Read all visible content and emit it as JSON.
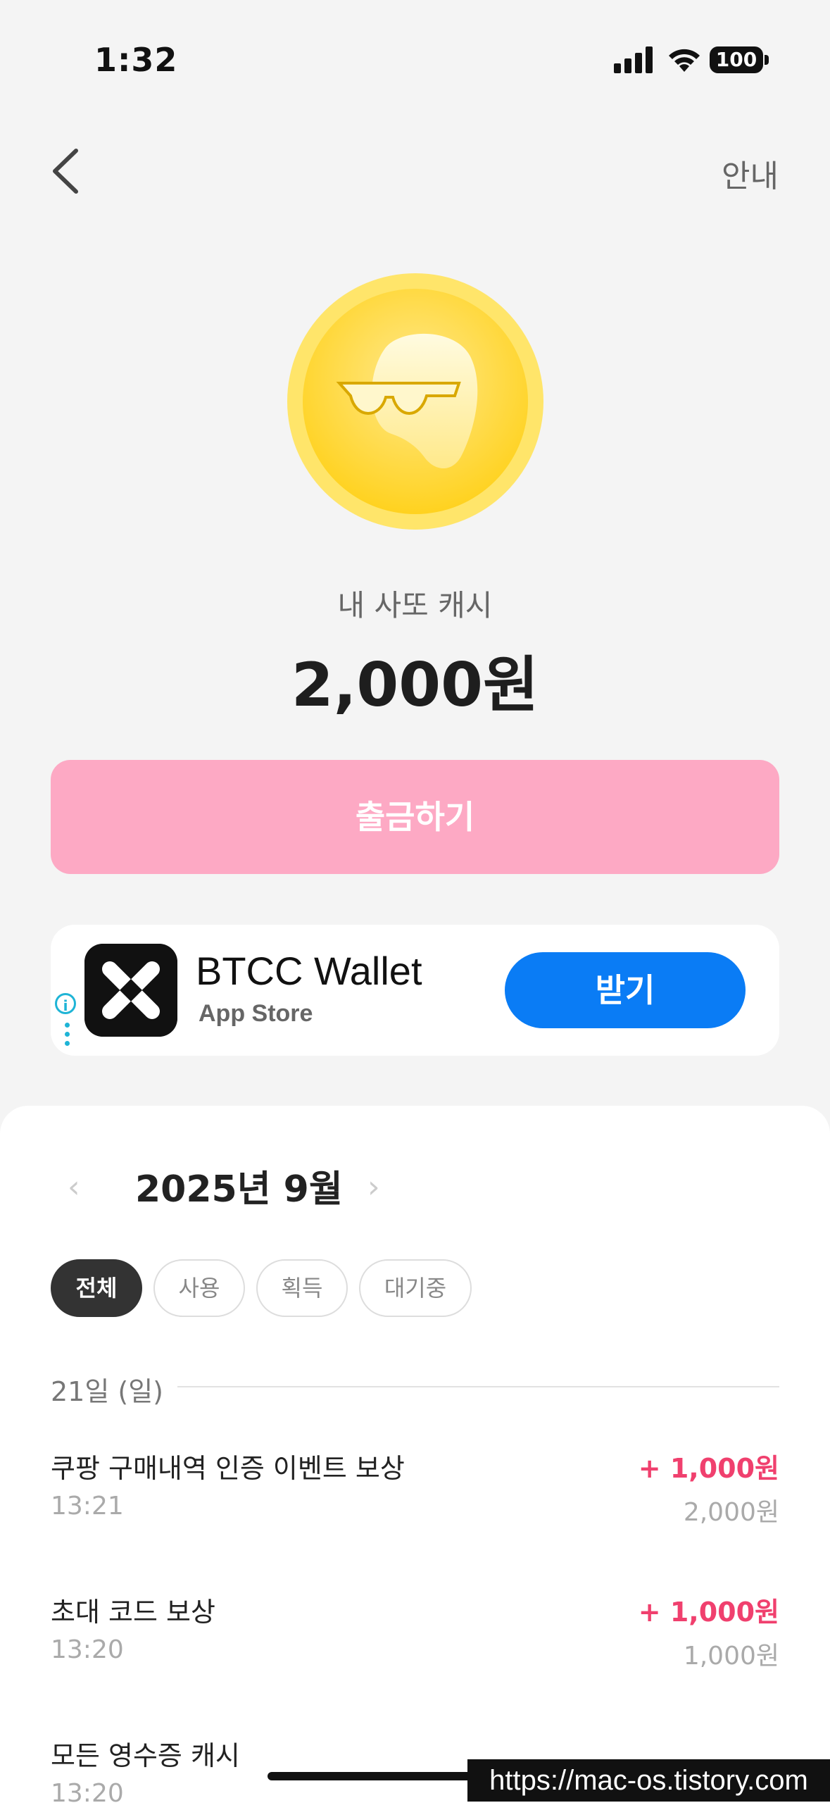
{
  "status_bar": {
    "time": "1:32",
    "battery": "100"
  },
  "nav": {
    "help_label": "안내"
  },
  "wallet": {
    "cash_label": "내 사또 캐시",
    "cash_amount": "2,000원",
    "withdraw_label": "출금하기"
  },
  "ad": {
    "app_name": "BTCC Wallet",
    "store": "App Store",
    "get_label": "받기"
  },
  "history": {
    "month": "2025년 9월",
    "filters": [
      "전체",
      "사용",
      "획득",
      "대기중"
    ],
    "date_header": "21일 (일)",
    "transactions": [
      {
        "title": "쿠팡 구매내역 인증 이벤트 보상",
        "time": "13:21",
        "amount": "+ 1,000원",
        "balance": "2,000원"
      },
      {
        "title": "초대 코드 보상",
        "time": "13:20",
        "amount": "+ 1,000원",
        "balance": "1,000원"
      },
      {
        "title": "모든 영수증 캐시",
        "time": "13:20"
      }
    ]
  },
  "watermark": "https://mac-os.tistory.com",
  "colors": {
    "accent_pink": "#fda9c4",
    "amount_pink": "#f0406e",
    "ad_blue": "#0a7cf5",
    "coin_gold": "#ffd93a"
  },
  "icons": [
    "back-chevron-icon",
    "signal-icon",
    "wifi-icon",
    "battery-icon",
    "coin-mascot-icon",
    "info-icon",
    "btcc-app-icon"
  ]
}
